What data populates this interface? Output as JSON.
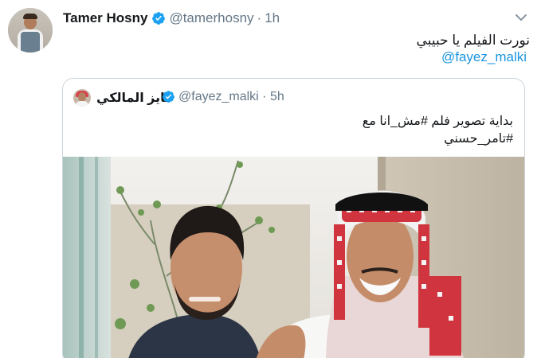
{
  "tweet": {
    "display_name": "Tamer Hosny",
    "handle": "@tamerhosny",
    "separator": "·",
    "time": "1h",
    "text": "نورت الفيلم يا حبيبي",
    "mention": "@fayez_malki",
    "avatar_icon": "profile-photo",
    "verified_icon": "verified-badge-icon",
    "menu_icon": "chevron-down-icon"
  },
  "quote": {
    "display_name": "فايز المالكي",
    "handle": "@fayez_malki",
    "separator": "·",
    "time": "5h",
    "text_line1": "بداية تصوير فلم #مش_انا مع",
    "text_line2": "#تامر_حسني",
    "photo": "two-men-selfie-photo"
  },
  "colors": {
    "link": "#1b95e0",
    "verified": "#1da1f2",
    "secondary_text": "#657786",
    "border": "#ccd6dd"
  }
}
